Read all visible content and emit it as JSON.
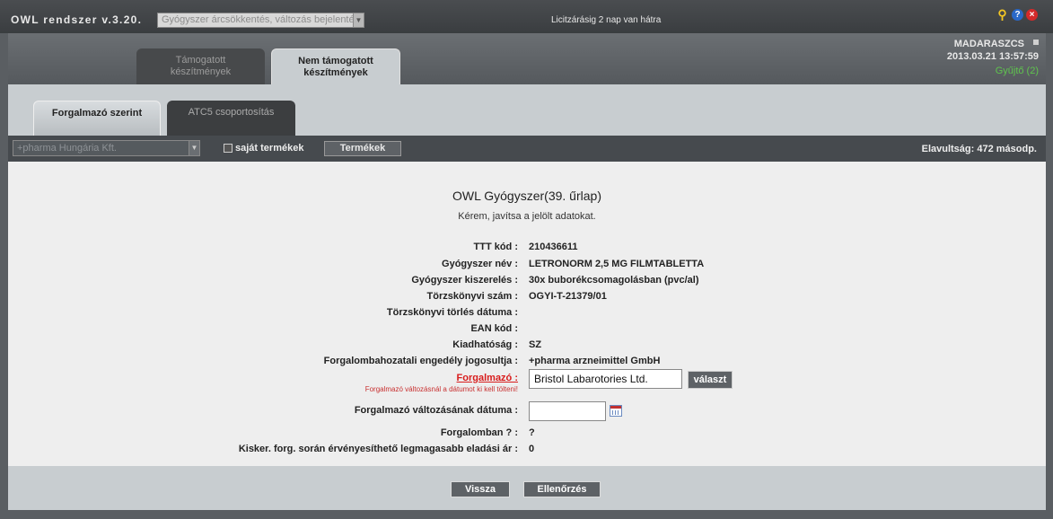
{
  "app": {
    "title": "OWL rendszer v.3.20.",
    "module_select": "Gyógyszer árcsökkentés, változás bejelentés",
    "deadline": "Licitzárásig 2 nap van hátra"
  },
  "user": {
    "name": "MADARASZCS",
    "datetime": "2013.03.21 13:57:59",
    "collector": "Gyűjtő (2)"
  },
  "tabs": {
    "supported": "Támogatott\nkészítmények",
    "unsupported": "Nem támogatott\nkészítmények"
  },
  "subtabs": {
    "distributor": "Forgalmazó szerint",
    "atc5": "ATC5 csoportosítás"
  },
  "filter": {
    "distributor_value": "+pharma Hungária Kft.",
    "own_products_label": "saját termékek",
    "own_products_checked": false,
    "products_button": "Termékek",
    "staleness": "Elavultság: 472 másodp."
  },
  "form": {
    "title": "OWL Gyógyszer(39. űrlap)",
    "subtitle": "Kérem, javítsa a jelölt adatokat.",
    "fields": {
      "ttt": {
        "label": "TTT kód :",
        "value": "210436611"
      },
      "name": {
        "label": "Gyógyszer név :",
        "value": "LETRONORM 2,5 MG FILMTABLETTA"
      },
      "package": {
        "label": "Gyógyszer kiszerelés :",
        "value": "30x buborékcsomagolásban (pvc/al)"
      },
      "registry": {
        "label": "Törzskönyvi szám :",
        "value": "OGYI-T-21379/01"
      },
      "registry_deletion": {
        "label": "Törzskönyvi törlés dátuma :",
        "value": ""
      },
      "ean": {
        "label": "EAN kód :",
        "value": ""
      },
      "dispensing": {
        "label": "Kiadhatóság :",
        "value": "SZ"
      },
      "license_holder": {
        "label": "Forgalombahozatali engedély jogosultja :",
        "value": "+pharma arzneimittel GmbH"
      },
      "distributor": {
        "label": "Forgalmazó :",
        "hint": "Forgalmazó változásnál a dátumot ki kell tölteni!",
        "value": "Bristol Labarotories Ltd.",
        "button": "választ"
      },
      "distributor_change_date": {
        "label": "Forgalmazó változásának dátuma :",
        "value": ""
      },
      "in_circulation": {
        "label": "Forgalomban ? :",
        "value": "?"
      },
      "max_price": {
        "label": "Kisker. forg. során érvényesíthető legmagasabb eladási ár :",
        "value": "0"
      }
    }
  },
  "footer": {
    "back": "Vissza",
    "check": "Ellenőrzés"
  },
  "colors": {
    "accent_green": "#5fc44e",
    "required_red": "#d81c1c"
  }
}
